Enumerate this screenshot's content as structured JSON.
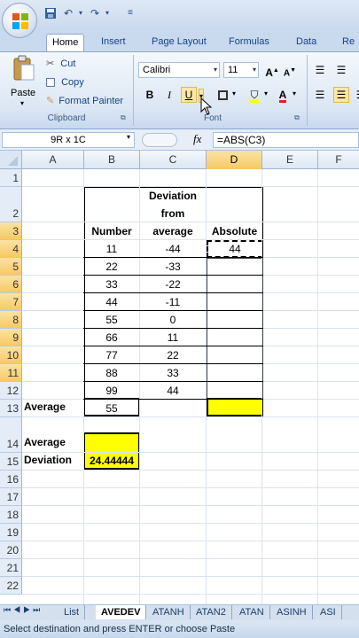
{
  "ribbon": {
    "tabs": [
      "Home",
      "Insert",
      "Page Layout",
      "Formulas",
      "Data",
      "Re"
    ],
    "clipboard": {
      "paste": "Paste",
      "cut": "Cut",
      "copy": "Copy",
      "format_painter": "Format Painter",
      "label": "Clipboard"
    },
    "font": {
      "name": "Calibri",
      "size": "11",
      "label": "Font"
    }
  },
  "formula_bar": {
    "name_box": "9R x 1C",
    "fx": "fx",
    "formula": "=ABS(C3)"
  },
  "columns": [
    "A",
    "B",
    "C",
    "D",
    "E",
    "F"
  ],
  "rows": [
    "1",
    "2",
    "3",
    "4",
    "5",
    "6",
    "7",
    "8",
    "9",
    "10",
    "11",
    "12",
    "13",
    "14",
    "15",
    "16",
    "17",
    "18",
    "19",
    "20",
    "21",
    "22"
  ],
  "table": {
    "header_b": "Number",
    "header_c": [
      "Deviation",
      "from",
      "average"
    ],
    "header_d": "Absolute",
    "numbers": [
      "11",
      "22",
      "33",
      "44",
      "55",
      "66",
      "77",
      "88",
      "99"
    ],
    "deviations": [
      "-44",
      "-33",
      "-22",
      "-11",
      "0",
      "11",
      "22",
      "33",
      "44"
    ],
    "absolute_first": "44",
    "average_label": "Average",
    "average_value": "55",
    "avg_dev_label": [
      "Average",
      "Deviation"
    ],
    "avg_dev_value": "24.44444"
  },
  "sheet_tabs": [
    "List",
    "AVEDEV",
    "ATANH",
    "ATAN2",
    "ATAN",
    "ASINH",
    "ASI"
  ],
  "status": "Select destination and press ENTER or choose Paste",
  "colors": {
    "highlight": "#ffff00",
    "accent": "#15428b"
  }
}
